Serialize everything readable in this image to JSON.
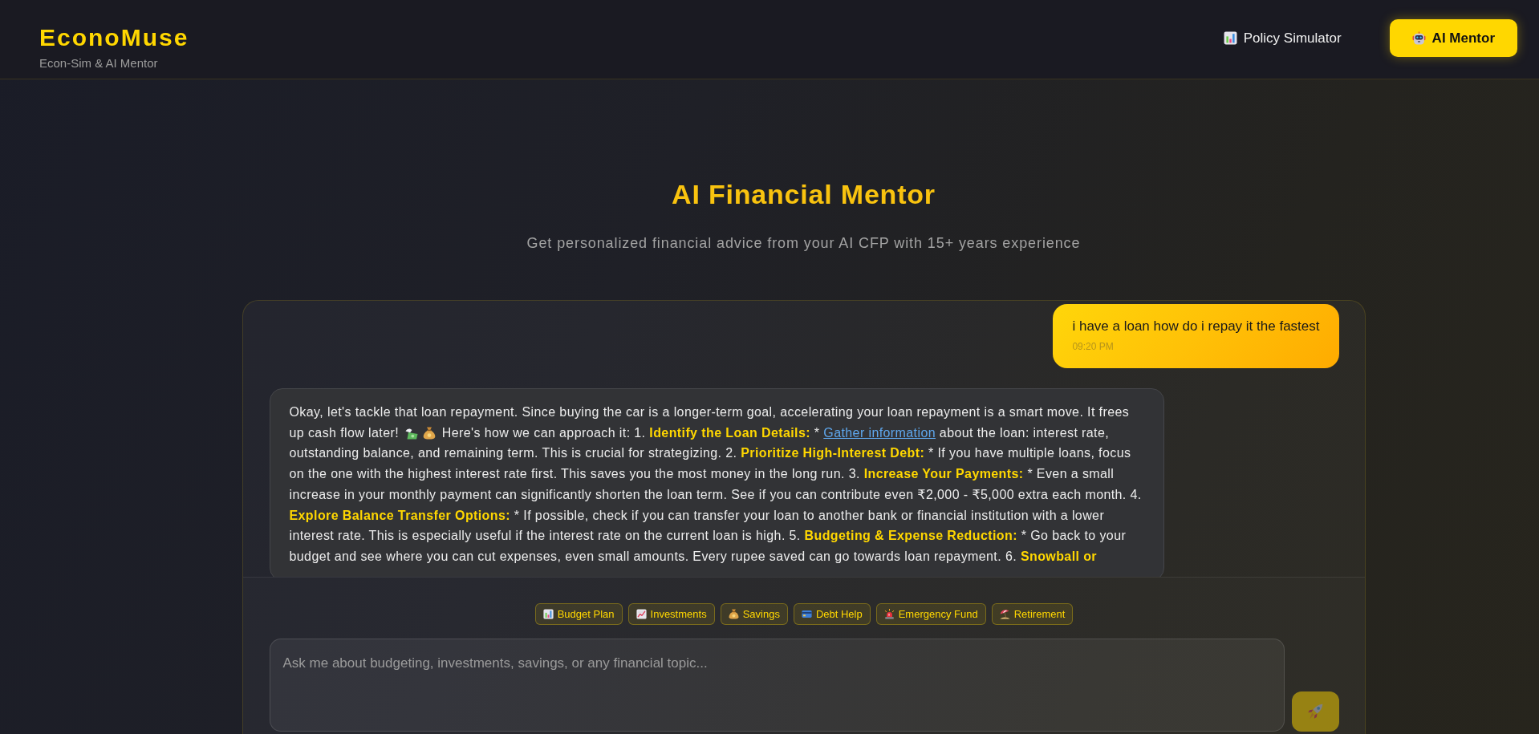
{
  "header": {
    "logo": "EconoMuse",
    "tagline": "Econ-Sim & AI Mentor",
    "nav": [
      {
        "label": "Policy Simulator",
        "selected": false
      },
      {
        "label": "AI Mentor",
        "selected": true
      }
    ]
  },
  "hero": {
    "title": "AI Financial Mentor",
    "subtitle": "Get personalized financial advice from your AI CFP with 15+ years experience"
  },
  "chat": {
    "messages": [
      {
        "kind": "user",
        "text": "i have a loan how do i repay it the fastest",
        "time": "09:20 PM"
      },
      {
        "kind": "assistant",
        "segments": [
          {
            "kind": "text",
            "text": "Okay, let's tackle that loan repayment. Since buying the car is a longer-term goal, accelerating your loan repayment is a smart move. It frees up cash flow later! "
          },
          {
            "kind": "icon"
          },
          {
            "kind": "icon"
          },
          {
            "kind": "text",
            "text": " Here's how we can approach it: 1. "
          },
          {
            "kind": "highlight",
            "text": "Identify the Loan Details:"
          },
          {
            "kind": "text",
            "text": " * "
          },
          {
            "kind": "link",
            "text": "Gather information"
          },
          {
            "kind": "text",
            "text": " about the loan: interest rate, outstanding balance, and remaining term. This is crucial for strategizing. 2. "
          },
          {
            "kind": "highlight",
            "text": "Prioritize High-Interest Debt:"
          },
          {
            "kind": "text",
            "text": " * If you have multiple loans, focus on the one with the highest interest rate first. This saves you the most money in the long run. 3. "
          },
          {
            "kind": "highlight",
            "text": "Increase Your Payments:"
          },
          {
            "kind": "text",
            "text": " * Even a small increase in your monthly payment can significantly shorten the loan term. See if you can contribute even ₹2,000 - ₹5,000 extra each month. 4. "
          },
          {
            "kind": "highlight",
            "text": "Explore Balance Transfer Options:"
          },
          {
            "kind": "text",
            "text": " * If possible, check if you can transfer your loan to another bank or financial institution with a lower interest rate. This is especially useful if the interest rate on the current loan is high. 5. "
          },
          {
            "kind": "highlight",
            "text": "Budgeting & Expense Reduction:"
          },
          {
            "kind": "text",
            "text": " * Go back to your budget and see where you can cut expenses, even small amounts. Every rupee saved can go towards loan repayment. 6. "
          },
          {
            "kind": "highlight",
            "text": "Snowball or"
          }
        ]
      }
    ],
    "quick_prompts": [
      {
        "label": "Budget Plan"
      },
      {
        "label": "Investments"
      },
      {
        "label": "Savings"
      },
      {
        "label": "Debt Help"
      },
      {
        "label": "Emergency Fund"
      },
      {
        "label": "Retirement"
      }
    ],
    "input": {
      "placeholder": "Ask me about budgeting, investments, savings, or any financial topic..."
    },
    "send_button": {
      "disabled": true
    }
  }
}
